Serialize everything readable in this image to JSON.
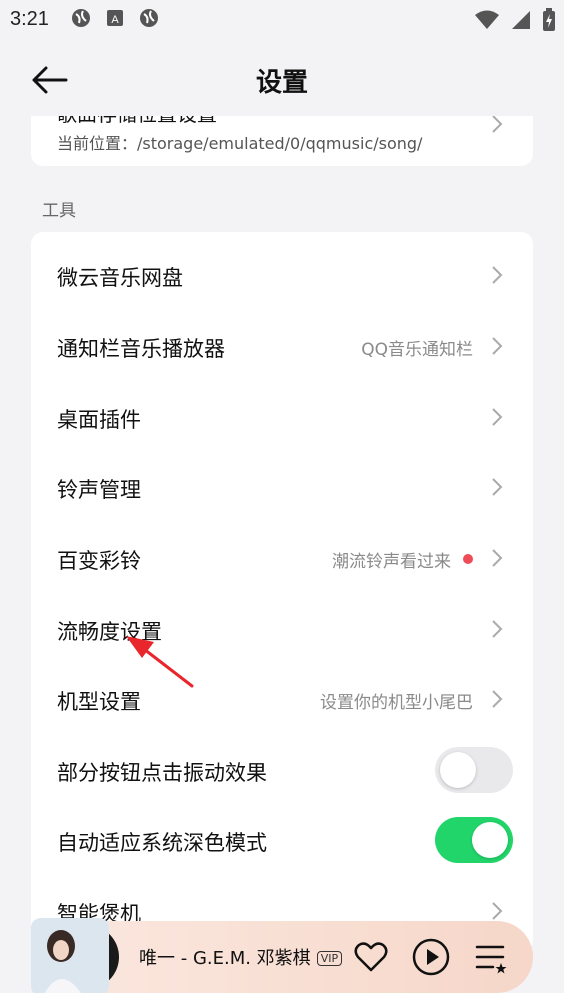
{
  "status_bar": {
    "time": "3:21"
  },
  "header": {
    "title": "设置"
  },
  "top_card": {
    "cut_title": "歌曲存储位置设置",
    "path_text": "当前位置：/storage/emulated/0/qqmusic/song/"
  },
  "section": {
    "label": "工具"
  },
  "rows": [
    {
      "label": "微云音乐网盘",
      "value": ""
    },
    {
      "label": "通知栏音乐播放器",
      "value": "QQ音乐通知栏"
    },
    {
      "label": "桌面插件",
      "value": ""
    },
    {
      "label": "铃声管理",
      "value": ""
    },
    {
      "label": "百变彩铃",
      "value": "潮流铃声看过来"
    },
    {
      "label": "流畅度设置",
      "value": ""
    },
    {
      "label": "机型设置",
      "value": "设置你的机型小尾巴"
    },
    {
      "label": "部分按钮点击振动效果",
      "toggle": "off"
    },
    {
      "label": "自动适应系统深色模式",
      "toggle": "on"
    },
    {
      "label": "智能煲机",
      "value": ""
    }
  ],
  "player": {
    "song": "唯一 - G.E.M. 邓紫棋",
    "vip": "VIP"
  },
  "colors": {
    "accent_green": "#22d56a",
    "red_dot": "#ef4b57",
    "annotation_arrow": "#e8262c"
  }
}
